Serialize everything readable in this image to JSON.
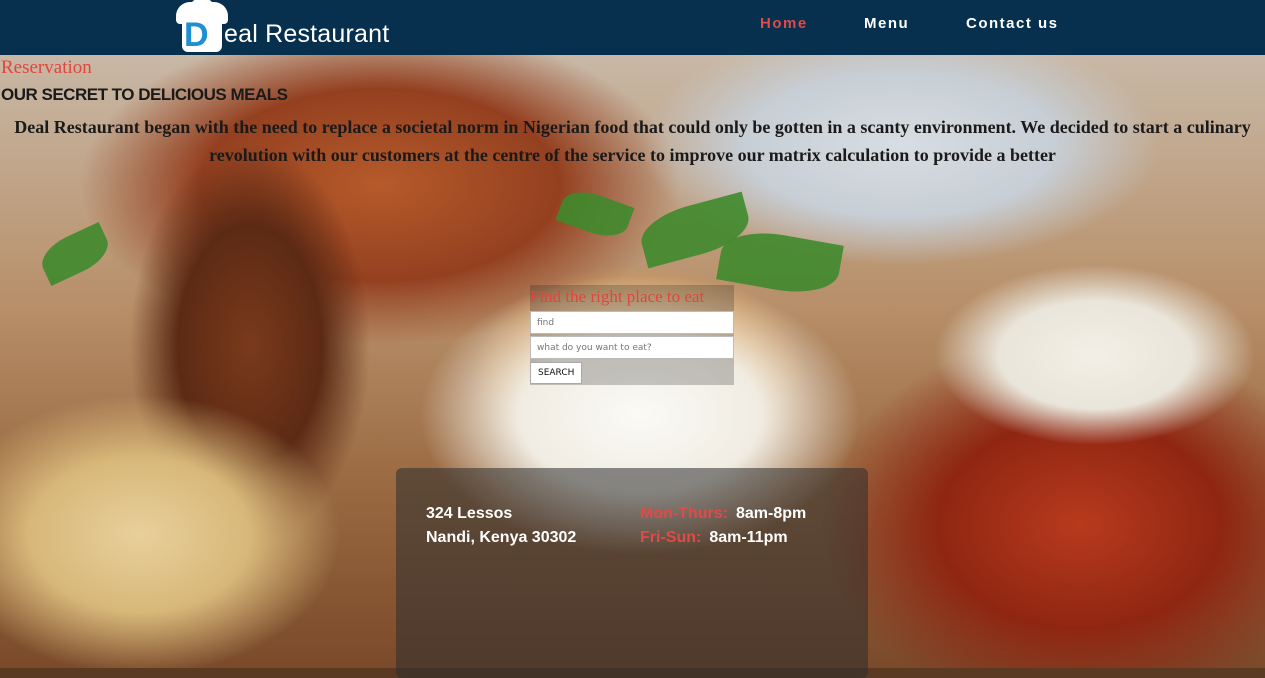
{
  "brand": {
    "logo_letter": "D",
    "name": "eal Restaurant"
  },
  "nav": {
    "items": [
      {
        "label": "Home",
        "active": true
      },
      {
        "label": "Menu",
        "active": false
      },
      {
        "label": "Contact us",
        "active": false
      }
    ]
  },
  "hero": {
    "reservation_link": "Reservation",
    "tagline": "OUR SECRET TO DELICIOUS MEALS",
    "about": "Deal Restaurant began with the need to replace a societal norm in Nigerian food that could only be gotten in a scanty environment. We decided to start a culinary revolution with our customers at the centre of the service to improve our matrix calculation to provide a better"
  },
  "search": {
    "title": "Find the right place to eat",
    "location_placeholder": "find",
    "food_placeholder": "what do you want to eat?",
    "button_label": "SEARCH"
  },
  "info": {
    "address_line1": "324 Lessos",
    "address_line2": "Nandi, Kenya 30302",
    "hours": [
      {
        "days": "Mon-Thurs:",
        "time": "8am-8pm"
      },
      {
        "days": "Fri-Sun:",
        "time": "8am-11pm"
      }
    ]
  },
  "colors": {
    "header_bg": "#06304e",
    "accent_red": "#e24a4a",
    "logo_blue": "#1e8fd0"
  }
}
